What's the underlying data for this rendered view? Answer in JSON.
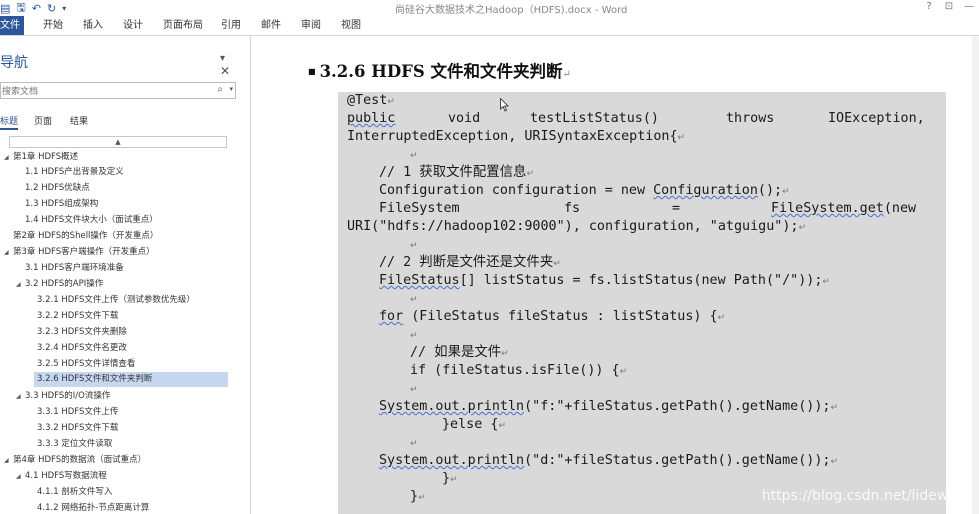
{
  "window": {
    "title": "尚硅谷大数据技术之Hadoop（HDFS).docx - Word",
    "controls": [
      "?",
      "⊡",
      "—"
    ]
  },
  "ribbon": {
    "tabs": [
      "文件",
      "开始",
      "插入",
      "设计",
      "页面布局",
      "引用",
      "邮件",
      "审阅",
      "视图"
    ]
  },
  "nav": {
    "title": "导航",
    "search_placeholder": "搜索文档",
    "tabs": [
      "标题",
      "页面",
      "结果"
    ],
    "items": [
      {
        "text": "第1章 HDFS概述"
      },
      {
        "text": "1.1 HDFS产出背景及定义"
      },
      {
        "text": "1.2 HDFS优缺点"
      },
      {
        "text": "1.3 HDFS组成架构"
      },
      {
        "text": "1.4 HDFS文件块大小（面试重点）"
      },
      {
        "text": "第2章 HDFS的Shell操作（开发重点）"
      },
      {
        "text": "第3章 HDFS客户端操作（开发重点）"
      },
      {
        "text": "3.1 HDFS客户端环境准备"
      },
      {
        "text": "3.2 HDFS的API操作"
      },
      {
        "text": "3.2.1 HDFS文件上传（测试参数优先级）"
      },
      {
        "text": "3.2.2 HDFS文件下载"
      },
      {
        "text": "3.2.3 HDFS文件夹删除"
      },
      {
        "text": "3.2.4 HDFS文件名更改"
      },
      {
        "text": "3.2.5 HDFS文件详情查看"
      },
      {
        "text": "3.2.6 HDFS文件和文件夹判断"
      },
      {
        "text": "3.3 HDFS的I/O流操作"
      },
      {
        "text": "3.3.1 HDFS文件上传"
      },
      {
        "text": "3.3.2 HDFS文件下载"
      },
      {
        "text": "3.3.3 定位文件读取"
      },
      {
        "text": "第4章 HDFS的数据流（面试重点）"
      },
      {
        "text": "4.1 HDFS写数据流程"
      },
      {
        "text": "4.1.1 剖析文件写入"
      },
      {
        "text": "4.1.2 网络拓扑-节点距离计算"
      }
    ]
  },
  "document": {
    "heading": "3.2.6 HDFS 文件和文件夹判断",
    "code": {
      "l1": "@Test",
      "l2a": "public",
      "l2b": "void",
      "l2c": "testListStatus()",
      "l2d": "throws",
      "l2e": "IOException,",
      "l3": "InterruptedException, URISyntaxException{",
      "c1": "// 1 获取文件配置信息",
      "l5a": "Configuration configuration = new ",
      "l5b": "Configuration",
      "l5c": "();",
      "l6a": "FileSystem",
      "l6b": "fs",
      "l6c": "=",
      "l6d": "FileSystem.get",
      "l6e": "(new",
      "l7": "URI(\"hdfs://hadoop102:9000\"), configuration, \"atguigu\");",
      "c2": "// 2 判断是文件还是文件夹",
      "l9a": "FileStatus",
      "l9b": "[] listStatus = fs.listStatus(new Path(\"/\"));",
      "l10a": "for",
      "l10b": " (FileStatus fileStatus : listStatus) {",
      "c3": "// 如果是文件",
      "l12": "if (fileStatus.isFile()) {",
      "l13a": "System.out.println",
      "l13b": "(\"f:\"+fileStatus.getPath().getName());",
      "l14": "}else {",
      "l15a": "System.out.println",
      "l15b": "(\"d:\"+fileStatus.getPath().getName());",
      "l16": "}",
      "l17": "}"
    },
    "watermark": "https://blog.csdn.net/lidew521"
  }
}
